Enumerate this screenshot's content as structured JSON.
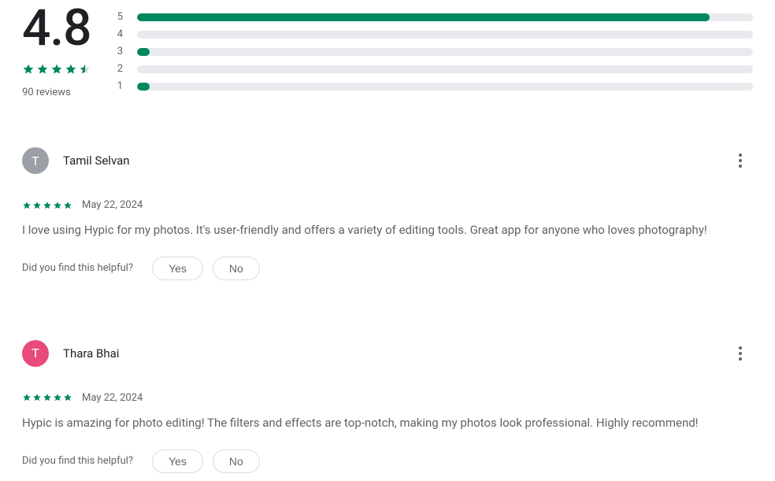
{
  "summary": {
    "score": "4.8",
    "stars": 4.5,
    "review_count": "90 reviews",
    "bars": [
      {
        "label": "5",
        "pct": 93
      },
      {
        "label": "4",
        "pct": 0
      },
      {
        "label": "3",
        "pct": 2
      },
      {
        "label": "2",
        "pct": 0
      },
      {
        "label": "1",
        "pct": 2
      }
    ]
  },
  "helpful_prompt": "Did you find this helpful?",
  "yes_label": "Yes",
  "no_label": "No",
  "reviews": [
    {
      "initial": "T",
      "avatar_bg": "#9aa0a6",
      "author": "Tamil Selvan",
      "stars": 5,
      "date": "May 22, 2024",
      "text": "I love using Hypic for my photos. It's user-friendly and offers a variety of editing tools. Great app for anyone who loves photography!"
    },
    {
      "initial": "T",
      "avatar_bg": "#e84a7a",
      "author": "Thara Bhai",
      "stars": 5,
      "date": "May 22, 2024",
      "text": "Hypic is amazing for photo editing! The filters and effects are top-notch, making my photos look professional. Highly recommend!"
    }
  ]
}
